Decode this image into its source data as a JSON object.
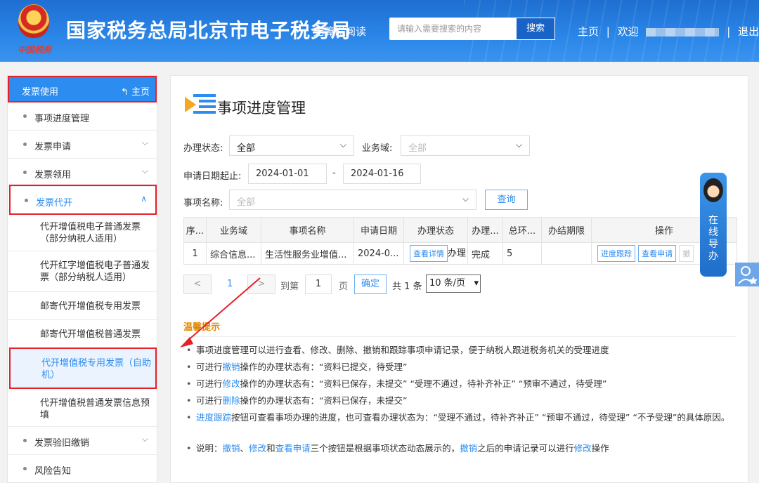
{
  "header": {
    "emblem_text": "中国税务",
    "title": "国家税务总局北京市电子税务局",
    "accessibility": "无障碍阅读",
    "search_placeholder": "请输入需要搜索的内容",
    "search_button": "搜索",
    "home": "主页",
    "welcome": "欢迎",
    "logout": "退出"
  },
  "sidebar": {
    "head_title": "发票使用",
    "head_home": "主页",
    "items": [
      {
        "label": "事项进度管理"
      },
      {
        "label": "发票申请"
      },
      {
        "label": "发票领用"
      },
      {
        "label": "发票代开"
      },
      {
        "label": "发票验旧缴销"
      },
      {
        "label": "风险告知"
      }
    ],
    "subitems": [
      {
        "label": "代开增值税电子普通发票（部分纳税人适用）"
      },
      {
        "label": "代开红字增值税电子普通发票（部分纳税人适用）"
      },
      {
        "label": "邮寄代开增值税专用发票"
      },
      {
        "label": "邮寄代开增值税普通发票"
      },
      {
        "label": "代开增值税专用发票（自助机）"
      },
      {
        "label": "代开增值税普通发票信息预填"
      }
    ]
  },
  "main": {
    "title": "事项进度管理",
    "status_label": "办理状态:",
    "status_value": "全部",
    "domain_label": "业务域:",
    "domain_placeholder": "全部",
    "date_label": "申请日期起止:",
    "date_from": "2024-01-01",
    "date_sep": "-",
    "date_to": "2024-01-16",
    "item_label": "事项名称:",
    "item_placeholder": "全部",
    "query_button": "查询"
  },
  "table": {
    "headers": [
      "序...",
      "业务域",
      "事项名称",
      "申请日期",
      "办理状态",
      "办理...",
      "总环...",
      "办结期限",
      "操作"
    ],
    "row": {
      "seq": "1",
      "domain": "综合信息...",
      "name": "生活性服务业增值...",
      "date": "2024-0...",
      "status_btn": "查看详情",
      "status_text": "办理",
      "result": "完成",
      "total": "5",
      "deadline": "",
      "op1": "进度跟踪",
      "op2": "查看申请",
      "op3": "撤"
    }
  },
  "pager": {
    "prev": "<",
    "page": "1",
    "next": ">",
    "goto": "到第",
    "input": "1",
    "page_unit": "页",
    "ok": "确定",
    "total": "共 1 条",
    "size": "10 条/页"
  },
  "tips": {
    "title": "温馨提示",
    "lines": [
      {
        "a": "事项进度管理可以进行查看、修改、删除、撤销和跟踪事项申请记录，便于纳税人跟进税务机关的受理进度"
      },
      {
        "a": "可进行",
        "h": "撤销",
        "b": "操作的办理状态有：“资料已提交，待受理”"
      },
      {
        "a": "可进行",
        "h": "修改",
        "b": "操作的办理状态有：“资料已保存，未提交”  “受理不通过，待补齐补正”  “预审不通过，待受理”"
      },
      {
        "a": "可进行",
        "h": "删除",
        "b": "操作的办理状态有：“资料已保存，未提交”"
      },
      {
        "h": "进度跟踪",
        "b": "按钮可查看事项办理的进度，也可查看办理状态为：“受理不通过，待补齐补正”  “预审不通过，待受理”  “不予受理”的具体原因。"
      },
      {
        "a": "说明：",
        "h": "撤销",
        "c": "、",
        "h2": "修改",
        "d": "和",
        "h3": "查看申请",
        "e": "三个按钮是根据事项状态动态展示的，",
        "h4": "撤销",
        "f": "之后的申请记录可以进行",
        "h5": "修改",
        "g": "操作"
      }
    ]
  },
  "helper": {
    "text": "在线导办"
  },
  "colors": {
    "brand_blue": "#2d8cf0",
    "header_blue": "#1f6fd1",
    "highlight_red": "#e5202a",
    "tips_orange": "#e08a00"
  }
}
